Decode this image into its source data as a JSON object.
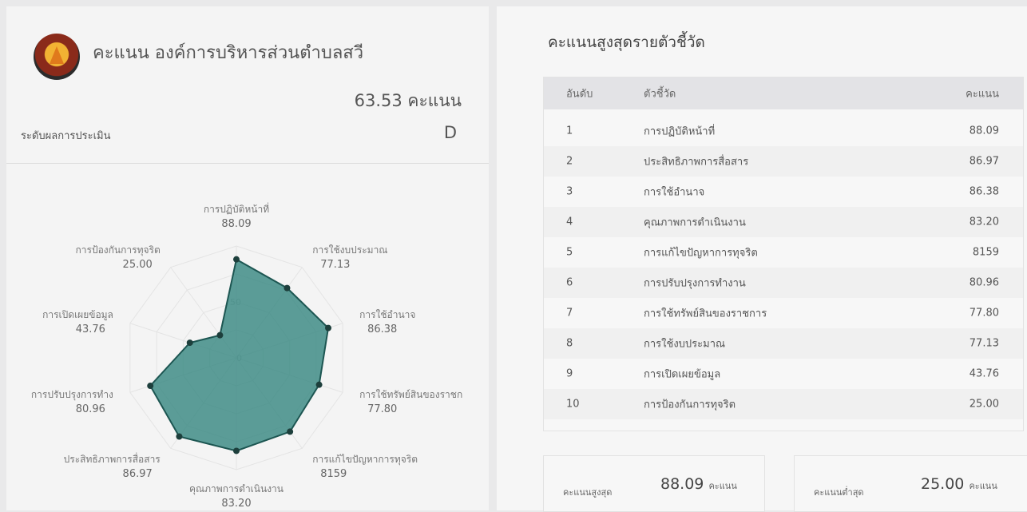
{
  "org": {
    "title": "คะแนน องค์การบริหารส่วนตำบลสวี",
    "score_text": "63.53 คะแนน",
    "grade_label": "ระดับผลการประเมิน",
    "grade_value": "D"
  },
  "radar": {
    "scale_labels": [
      "50",
      "0"
    ],
    "fill_color": "#3f8c86",
    "stroke_color": "#1d5652",
    "axes": [
      {
        "label": "การปฏิบัติหน้าที่",
        "value": 88.09,
        "value_text": "88.09"
      },
      {
        "label": "การใช้งบประมาณ",
        "value": 77.13,
        "value_text": "77.13"
      },
      {
        "label": "การใช้อำนาจ",
        "value": 86.38,
        "value_text": "86.38"
      },
      {
        "label": "การใช้ทรัพย์สินของราชก",
        "value": 77.8,
        "value_text": "77.80"
      },
      {
        "label": "การแก้ไขปัญหาการทุจริต",
        "value": 81.59,
        "value_text": "8159"
      },
      {
        "label": "คุณภาพการดำเนินงาน",
        "value": 83.2,
        "value_text": "83.20"
      },
      {
        "label": "ประสิทธิภาพการสื่อสาร",
        "value": 86.97,
        "value_text": "86.97"
      },
      {
        "label": "การปรับปรุงการทำง",
        "value": 80.96,
        "value_text": "80.96"
      },
      {
        "label": "การเปิดเผยข้อมูล",
        "value": 43.76,
        "value_text": "43.76"
      },
      {
        "label": "การป้องกันการทุจริต",
        "value": 25.0,
        "value_text": "25.00"
      }
    ]
  },
  "ranking": {
    "title": "คะแนนสูงสุดรายตัวชี้วัด",
    "headers": {
      "rank": "อันดับ",
      "indicator": "ตัวชี้วัด",
      "score": "คะแนน"
    },
    "rows": [
      {
        "rank": "1",
        "indicator": "การปฏิบัติหน้าที่",
        "score": "88.09"
      },
      {
        "rank": "2",
        "indicator": "ประสิทธิภาพการสื่อสาร",
        "score": "86.97"
      },
      {
        "rank": "3",
        "indicator": "การใช้อำนาจ",
        "score": "86.38"
      },
      {
        "rank": "4",
        "indicator": "คุณภาพการดำเนินงาน",
        "score": "83.20"
      },
      {
        "rank": "5",
        "indicator": "การแก้ไขปัญหาการทุจริต",
        "score": "8159"
      },
      {
        "rank": "6",
        "indicator": "การปรับปรุงการทำงาน",
        "score": "80.96"
      },
      {
        "rank": "7",
        "indicator": "การใช้ทรัพย์สินของราชการ",
        "score": "77.80"
      },
      {
        "rank": "8",
        "indicator": "การใช้งบประมาณ",
        "score": "77.13"
      },
      {
        "rank": "9",
        "indicator": "การเปิดเผยข้อมูล",
        "score": "43.76"
      },
      {
        "rank": "10",
        "indicator": "การป้องกันการทุจริต",
        "score": "25.00"
      }
    ]
  },
  "summary": {
    "max_label": "คะแนนสูงสุด",
    "max_value": "88.09",
    "min_label": "คะแนนต่ำสุด",
    "min_value": "25.00",
    "unit": "คะแนน"
  }
}
